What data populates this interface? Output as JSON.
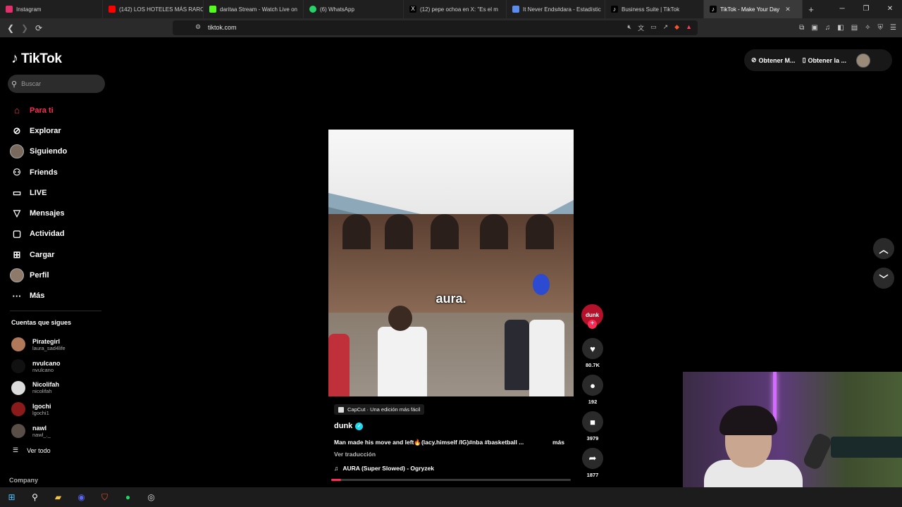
{
  "browser": {
    "tabs": [
      {
        "title": "Instagram",
        "color": "#e1306c"
      },
      {
        "title": "(142) LOS HOTELES MÁS RARO",
        "color": "#ff0000"
      },
      {
        "title": "daritaa Stream - Watch Live on",
        "color": "#53fc18"
      },
      {
        "title": "(6) WhatsApp",
        "color": "#25d366"
      },
      {
        "title": "(12) pepe ochoa en X: \"Es el m",
        "color": "#ffffff"
      },
      {
        "title": "It Never Ends#dara - Estadístic",
        "color": "#5a8dee"
      },
      {
        "title": "Business Suite | TikTok",
        "color": "#ffffff"
      },
      {
        "title": "TikTok - Make Your Day",
        "color": "#ffffff"
      }
    ],
    "url": "tiktok.com"
  },
  "tiktok": {
    "logo_text": "TikTok",
    "search_placeholder": "Buscar",
    "menu": [
      {
        "label": "Para ti",
        "icon": "home-icon"
      },
      {
        "label": "Explorar",
        "icon": "compass-icon"
      },
      {
        "label": "Siguiendo",
        "icon": "avatar"
      },
      {
        "label": "Friends",
        "icon": "friends-icon"
      },
      {
        "label": "LIVE",
        "icon": "live-icon"
      },
      {
        "label": "Mensajes",
        "icon": "send-icon"
      },
      {
        "label": "Actividad",
        "icon": "activity-icon"
      },
      {
        "label": "Cargar",
        "icon": "upload-icon"
      },
      {
        "label": "Perfil",
        "icon": "avatar"
      },
      {
        "label": "Más",
        "icon": "more-icon"
      }
    ],
    "following_header": "Cuentas que sigues",
    "following": [
      {
        "name": "Pirategirl",
        "handle": "laura_sad4life",
        "color": "#b07a5a"
      },
      {
        "name": "nvulcano",
        "handle": "nvulcano",
        "color": "#111111"
      },
      {
        "name": "Nicolifah",
        "handle": "nicolifah",
        "color": "#dcdcdc"
      },
      {
        "name": "lgochi",
        "handle": "lgochi1",
        "color": "#8b1a1a"
      },
      {
        "name": "nawl",
        "handle": "nawl_._",
        "color": "#5a4f48"
      }
    ],
    "see_all": "Ver todo",
    "company": "Company",
    "top_right": {
      "btn1": "Obtener M...",
      "btn2": "Obtener la ..."
    },
    "video": {
      "caption": "aura.",
      "badge": "CapCut · Una edición más fácil",
      "author": "dunk",
      "description": "Man made his move and left🔥(lacy.himself /IG)#nba #basketball ...",
      "more": "más",
      "translate": "Ver traducción",
      "music": "AURA (Super Slowed) - Ogryzek",
      "progress": 0.04
    },
    "actions": {
      "creator_label": "dunk",
      "likes": "80.7K",
      "comments": "192",
      "saves": "3979",
      "shares": "1877"
    }
  }
}
